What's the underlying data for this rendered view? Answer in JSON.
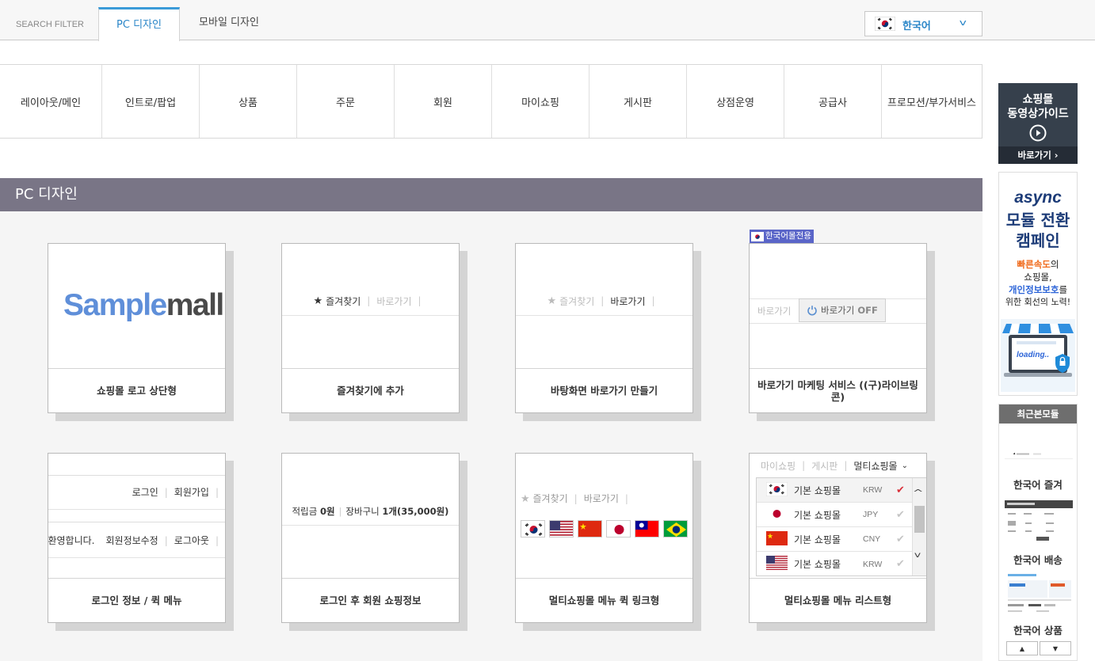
{
  "header": {
    "search_filter": "SEARCH FILTER",
    "tabs": [
      "PC 디자인",
      "모바일 디자인"
    ],
    "language": {
      "label": "한국어",
      "flag": "korea-flag"
    }
  },
  "categories": [
    "레이아웃/메인",
    "인트로/팝업",
    "상품",
    "주문",
    "회원",
    "마이쇼핑",
    "게시판",
    "상점운영",
    "공급사",
    "프로모션/부가서비스"
  ],
  "section_title": "PC 디자인",
  "cards": [
    {
      "title": "쇼핑몰 로고 상단형",
      "logo": {
        "part1": "Sample",
        "part2": "mall"
      }
    },
    {
      "title": "즐겨찾기에 추가",
      "preview": {
        "favorite": "즐겨찾기",
        "shortcut": "바로가기",
        "sep": "|"
      }
    },
    {
      "title": "바탕화면 바로가기 만들기",
      "preview": {
        "favorite": "즐겨찾기",
        "shortcut": "바로가기",
        "sep": "|"
      }
    },
    {
      "title": "바로가기 마케팅 서비스 ((구)라이브링콘)",
      "badge": "한국어몰전용",
      "preview": {
        "shortcut": "바로가기",
        "off_button": "바로가기",
        "off_state": "OFF"
      }
    },
    {
      "title": "로그인 정보 / 퀵 메뉴",
      "preview": {
        "login": "로그인",
        "join": "회원가입",
        "welcome": "환영합니다.",
        "edit": "회원정보수정",
        "logout": "로그아웃",
        "sep": "|"
      }
    },
    {
      "title": "로그인 후 회원 쇼핑정보",
      "preview": {
        "points_label": "적립금",
        "points_value": "0원",
        "cart_label": "장바구니",
        "cart_value": "1개(35,000원)",
        "sep": "|"
      }
    },
    {
      "title": "멀티쇼핑몰 메뉴 퀵 링크형",
      "preview": {
        "favorite": "즐겨찾기",
        "shortcut": "바로가기",
        "sep": "|",
        "flags": [
          "korea-flag",
          "usa-flag",
          "china-flag",
          "japan-flag",
          "taiwan-flag",
          "brazil-flag"
        ]
      }
    },
    {
      "title": "멀티쇼핑몰 메뉴 리스트형",
      "preview": {
        "myshop": "마이쇼핑",
        "board": "게시판",
        "multi": "멀티쇼핑몰",
        "sep": "|",
        "items": [
          {
            "flag": "korea-flag",
            "name": "기본 쇼핑몰",
            "currency": "KRW",
            "selected": true
          },
          {
            "flag": "japan-flag",
            "name": "기본 쇼핑몰",
            "currency": "JPY",
            "selected": false
          },
          {
            "flag": "china-flag",
            "name": "기본 쇼핑몰",
            "currency": "CNY",
            "selected": false
          },
          {
            "flag": "usa-flag",
            "name": "기본 쇼핑몰",
            "currency": "KRW",
            "selected": false
          }
        ]
      }
    }
  ],
  "sidebar": {
    "video_banner": {
      "line1": "쇼핑몰",
      "line2": "동영상가이드",
      "link": "바로가기 ›"
    },
    "async_banner": {
      "title1": "async",
      "title2": "모듈 전환",
      "title3": "캠페인",
      "hl1": "빠른속도",
      "t1": "의",
      "t2": "쇼핑몰,",
      "hl2": "개인정보보호",
      "t3": "를",
      "t4": "위한 회선의 노력!",
      "loading": "loading.."
    },
    "recent": {
      "title": "최근본모듈",
      "items": [
        "한국어 즐겨",
        "한국어 배송",
        "한국어 상품"
      ]
    }
  },
  "colors": {
    "accent": "#2a86c8",
    "section_bar": "#797586",
    "check_red": "#d9303a",
    "badge": "#5a65c8"
  }
}
